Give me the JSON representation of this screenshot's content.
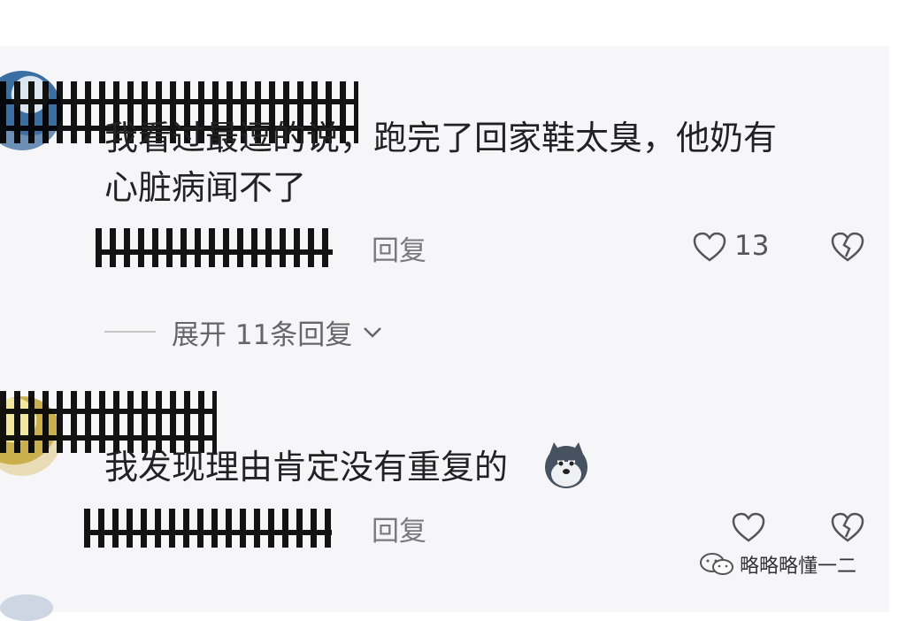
{
  "comments": [
    {
      "text_line1": "我看过最逗的说，跑完了回家鞋太臭，他奶有",
      "text_line2": "心脏病闻不了",
      "reply_label": "回复",
      "like_count": "13",
      "expand_label": "展开 11条回复"
    },
    {
      "text": "我发现理由肯定没有重复的",
      "reply_label": "回复",
      "like_count": ""
    }
  ],
  "watermark": {
    "text": "略略略懂一二"
  },
  "icons": {
    "like": "heart-outline-icon",
    "dislike": "broken-heart-icon",
    "expand": "chevron-down-icon",
    "emoji": "husky-dog-emoji",
    "watermark": "wechat-icon"
  }
}
